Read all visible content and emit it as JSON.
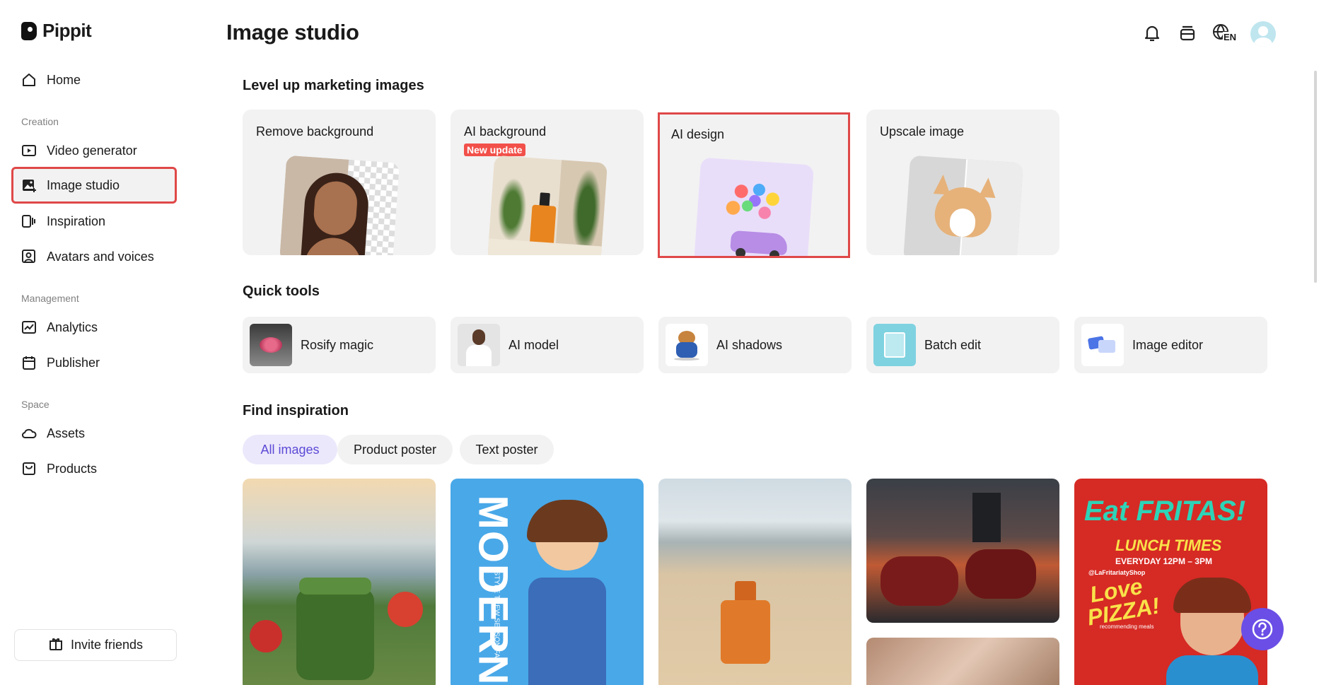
{
  "app": {
    "name": "Pippit"
  },
  "sidebar": {
    "home": "Home",
    "sections": [
      "Creation",
      "Management",
      "Space"
    ],
    "creation": [
      "Video generator",
      "Image studio",
      "Inspiration",
      "Avatars and voices"
    ],
    "management": [
      "Analytics",
      "Publisher"
    ],
    "space": [
      "Assets",
      "Products"
    ],
    "invite": "Invite friends"
  },
  "header": {
    "title": "Image studio",
    "language": "EN"
  },
  "features": {
    "heading": "Level up marketing images",
    "cards": [
      {
        "title": "Remove background"
      },
      {
        "title": "AI background",
        "badge": "New update"
      },
      {
        "title": "AI design"
      },
      {
        "title": "Upscale image"
      }
    ]
  },
  "quick_tools": {
    "heading": "Quick tools",
    "items": [
      "Rosify magic",
      "AI model",
      "AI shadows",
      "Batch edit",
      "Image editor"
    ]
  },
  "inspiration": {
    "heading": "Find inspiration",
    "filters": [
      "All images",
      "Product poster",
      "Text poster"
    ],
    "poster_text": {
      "modern": "MODERN",
      "modern_sub": "STYLE TREW SEASON FA",
      "fritas": "Eat FRITAS!",
      "lunch": "LUNCH TIMES",
      "everyday": "EVERYDAY 12PM – 3PM",
      "shop": "@LaFritariatyShop",
      "love": "Love",
      "pizza": "PIZZA!",
      "recommending": "recommending meals"
    }
  },
  "colors": {
    "accent": "#6a4ee6",
    "highlight": "#e04848",
    "badge": "#f2504a",
    "card_bg": "#f2f2f2"
  }
}
